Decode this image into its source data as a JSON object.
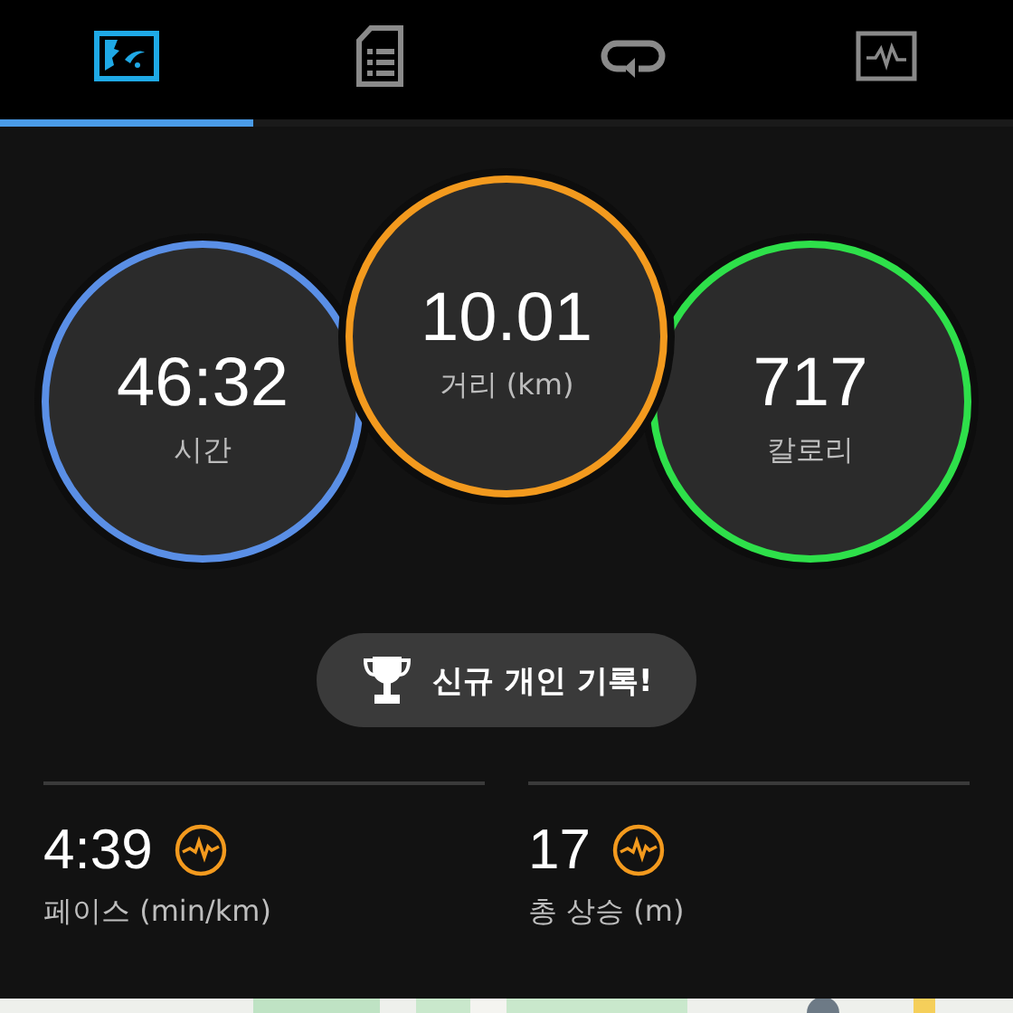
{
  "tabs": [
    {
      "kind": "overview",
      "selected": true
    },
    {
      "kind": "details",
      "selected": false
    },
    {
      "kind": "laps",
      "selected": false
    },
    {
      "kind": "charts",
      "selected": false
    }
  ],
  "stats": [
    {
      "value": "46:32",
      "label": "시간",
      "color": "#5a8fe6"
    },
    {
      "value": "10.01",
      "label": "거리 (km)",
      "color": "#f39a1e"
    },
    {
      "value": "717",
      "label": "칼로리",
      "color": "#2ee04a"
    }
  ],
  "record_button": {
    "label": "신규 개인 기록!"
  },
  "metrics": [
    {
      "value": "4:39",
      "label": "페이스 (min/km)"
    },
    {
      "value": "17",
      "label": "총 상승 (m)"
    }
  ]
}
